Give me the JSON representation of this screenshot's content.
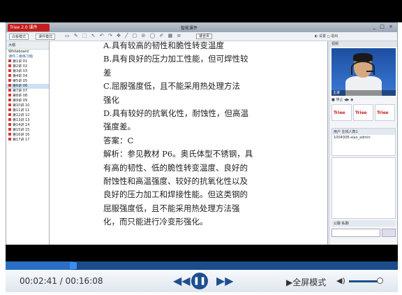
{
  "app": {
    "logo_text": "Triee 2.0 课件",
    "window_title": "智能课件",
    "window_buttons": "_ □ ×",
    "tab_whiteboard": "白板模式",
    "tab_courseware": "课件模式",
    "zoom": "适合页",
    "right_tools": "◐ 设置  ◻ 退出"
  },
  "sidebar": {
    "header": "大纲",
    "section1": "Whiteboard",
    "section2": "课件二级练习题",
    "items": [
      "第1讲 01",
      "第2讲 02",
      "第3讲 03",
      "第4讲 04",
      "第5讲 05",
      "第6讲 06",
      "第7讲 07",
      "第8讲 08",
      "第9讲 09",
      "第10讲 10",
      "第11讲 11",
      "第12讲 12",
      "第13讲 13",
      "第14讲 14",
      "第15讲 15",
      "第16讲 16",
      "第17讲 17"
    ]
  },
  "document": {
    "lines": [
      "A.具有较高的韧性和脆性转变温度",
      "B.具有良好的压力加工性能，但可焊性较",
      "差",
      "C.屈服强度低，且不能采用热处理方法",
      "强化",
      "D.具有较好的抗氧化性，耐蚀性，但高温",
      "强度差。",
      "答案：C",
      "解析：参见教材 P6。奥氏体型不锈钢，具",
      "有高的韧性、低的脆性转变温度、良好的",
      "耐蚀性和高温强度、较好的抗氧化性以及",
      "良好的压力加工和焊接性能。但这类钢的",
      "屈服强度低，且不能采用热处理方法强",
      "化，而只能进行冷变形强化。"
    ]
  },
  "right_panel": {
    "top_label": "视频",
    "video_label": "主讲",
    "controls": "■ 停止  ◀▶  ◉",
    "cards": [
      "Triee",
      "Triee",
      "Triee"
    ],
    "users_header": "用户 在线人数1",
    "user_name": "1004008-xiao_admin",
    "chat_header": "公聊  私聊"
  },
  "player": {
    "current_time": "00:02:41",
    "total_time": "/ 00:16:08",
    "fullscreen_label": "▶全屏模式",
    "progress": 0.17
  }
}
